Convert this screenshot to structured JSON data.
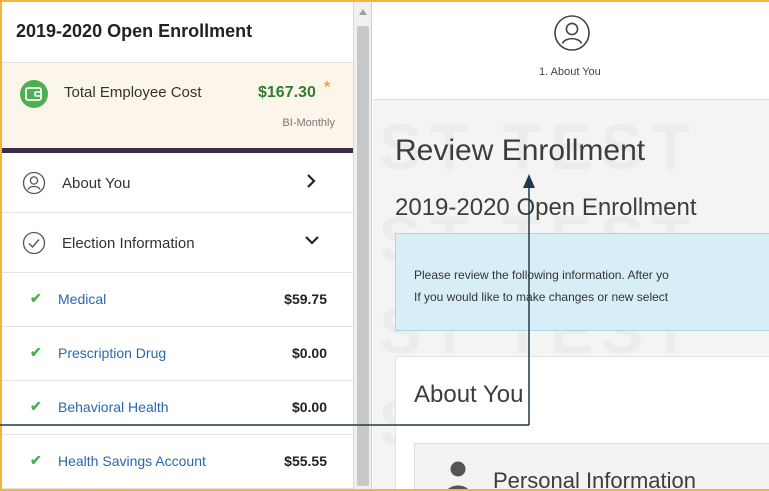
{
  "sidebar": {
    "title": "2019-2020 Open Enrollment",
    "cost": {
      "label": "Total Employee Cost",
      "amount": "$167.30",
      "asterisk": "*",
      "frequency": "BI-Monthly",
      "icon": "wallet-icon"
    },
    "sections": [
      {
        "label": "About You",
        "icon": "user-circle-icon",
        "chevron": "chevron-right-icon"
      },
      {
        "label": "Election Information",
        "icon": "check-circle-icon",
        "chevron": "chevron-down-icon"
      }
    ],
    "benefits": [
      {
        "label": "Medical",
        "amount": "$59.75",
        "icon": "check-icon"
      },
      {
        "label": "Prescription Drug",
        "amount": "$0.00",
        "icon": "check-icon"
      },
      {
        "label": "Behavioral Health",
        "amount": "$0.00",
        "icon": "check-icon"
      },
      {
        "label": "Health Savings Account",
        "amount": "$55.55",
        "icon": "check-icon"
      }
    ]
  },
  "steps": {
    "current": {
      "label": "1. About You",
      "icon": "user-circle-icon"
    }
  },
  "main": {
    "title": "Review Enrollment",
    "subtitle": "2019-2020 Open Enrollment",
    "info_line1": "Please review the following information. After yo",
    "info_line2": "If you would like to make changes or new select",
    "about_title": "About You",
    "personal_label": "Personal Information",
    "watermark": "ST TEST"
  },
  "colors": {
    "frame": "#f4b53f",
    "cost_green": "#2e7d32",
    "link_blue": "#2a67b0",
    "check_green": "#4caf50",
    "info_bg": "#d8eef6",
    "divider_purple": "#3e2a4e"
  }
}
